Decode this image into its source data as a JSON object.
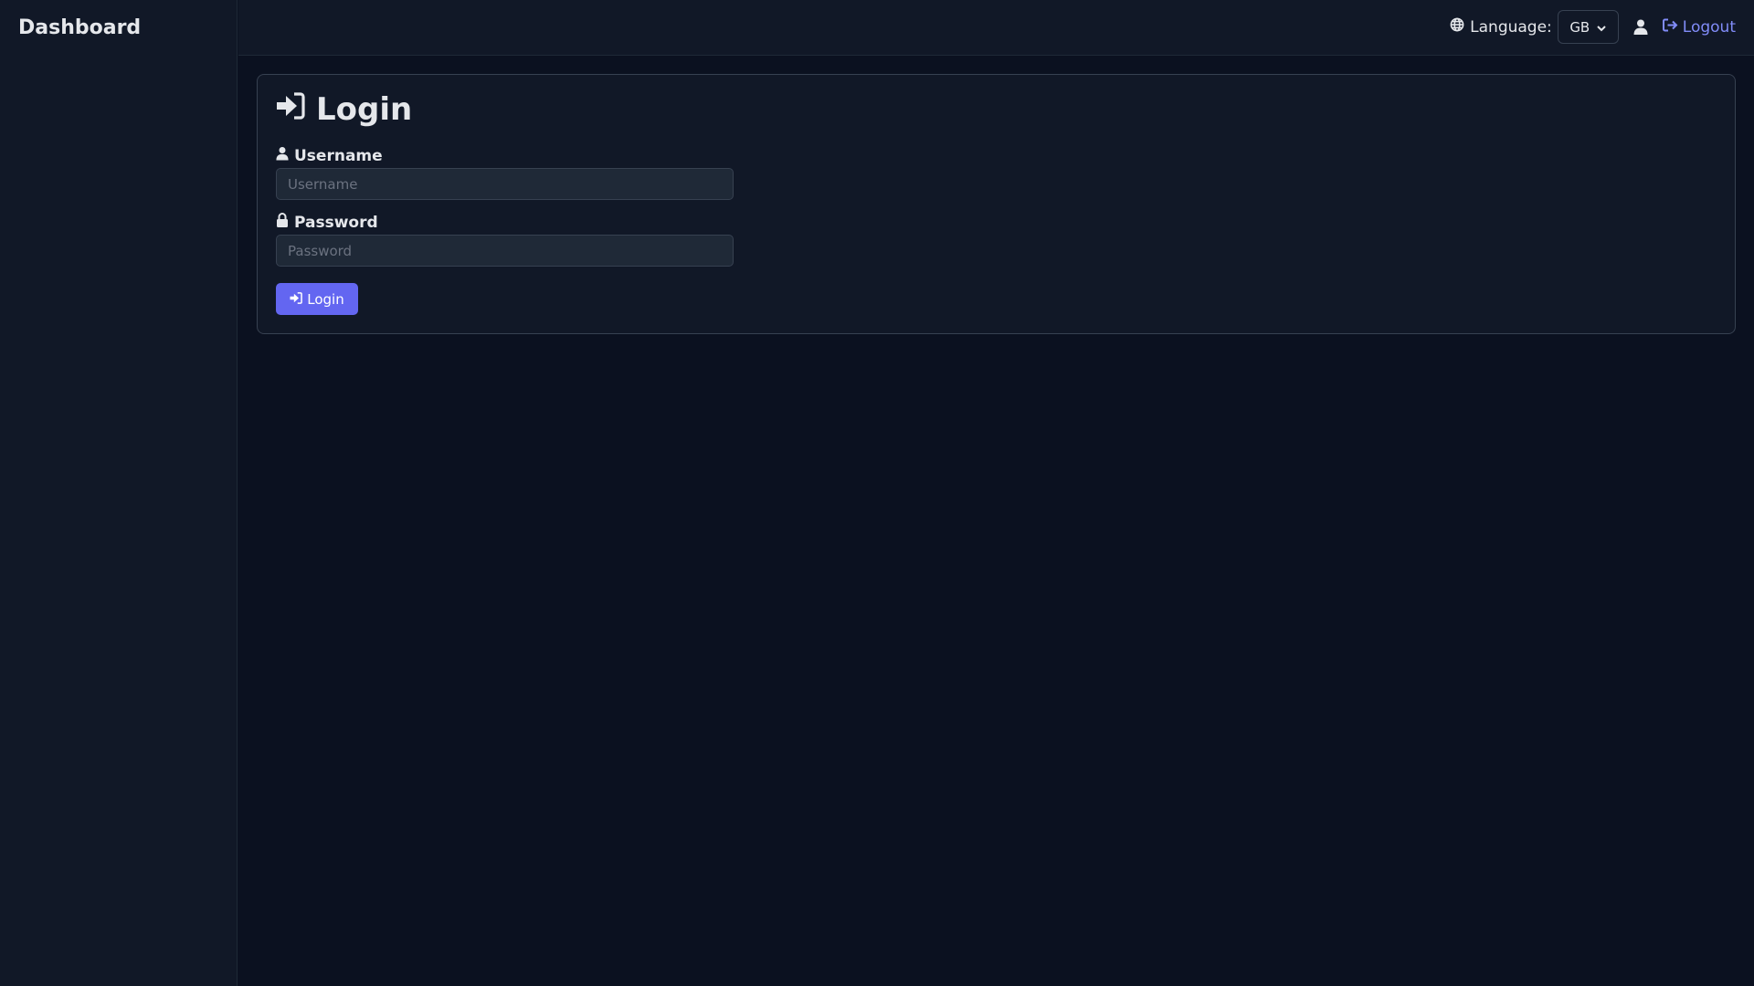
{
  "sidebar": {
    "title": "Dashboard"
  },
  "header": {
    "language_label": "Language:",
    "language_value": "GB",
    "logout_label": "Logout",
    "icons": {
      "globe": "globe-icon",
      "chevron": "chevron-down-icon",
      "user": "user-icon",
      "logout": "logout-icon"
    }
  },
  "login": {
    "title": "Login",
    "username_label": "Username",
    "username_placeholder": "Username",
    "username_value": "",
    "password_label": "Password",
    "password_placeholder": "Password",
    "password_value": "",
    "submit_label": "Login",
    "icons": {
      "title": "sign-in-icon",
      "username": "user-icon",
      "password": "lock-icon",
      "submit": "sign-in-icon"
    }
  },
  "colors": {
    "background": "#0b1120",
    "panel": "#111827",
    "border": "#374151",
    "accent": "#6366f1",
    "link": "#818cf8",
    "text": "#e5e7eb"
  }
}
